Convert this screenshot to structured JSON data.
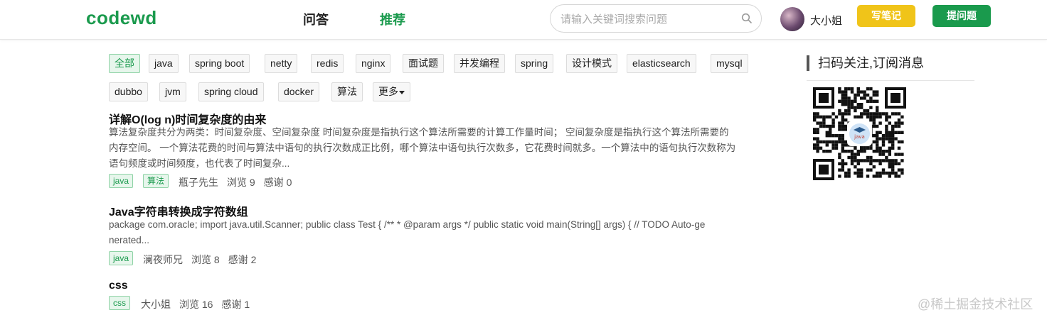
{
  "header": {
    "logo": "codewd",
    "nav": [
      {
        "label": "问答",
        "active": false
      },
      {
        "label": "推荐",
        "active": true
      }
    ],
    "search_placeholder": "请输入关键词搜索问题",
    "user_name": "大小姐",
    "write_note_label": "写笔记",
    "ask_label": "提问题"
  },
  "tags": [
    {
      "label": "全部",
      "active": true
    },
    {
      "label": "java"
    },
    {
      "label": "spring boot"
    },
    {
      "label": "netty"
    },
    {
      "label": "redis"
    },
    {
      "label": "nginx"
    },
    {
      "label": "面试题"
    },
    {
      "label": "并发编程"
    },
    {
      "label": "spring"
    },
    {
      "label": "设计模式"
    },
    {
      "label": "elasticsearch"
    },
    {
      "label": "mysql"
    },
    {
      "label": "dubbo"
    },
    {
      "label": "jvm"
    },
    {
      "label": "spring cloud"
    },
    {
      "label": "docker"
    },
    {
      "label": "算法"
    },
    {
      "label": "更多"
    }
  ],
  "articles": [
    {
      "title": "详解O(log n)时间复杂度的由来",
      "summary_lines": [
        "算法复杂度共分为两类：时间复杂度、空间复杂度 时间复杂度是指执行这个算法所需要的计算工作量时间；  空间复杂度是指执行这个算法所需要的",
        "内存空间。 一个算法花费的时间与算法中语句的执行次数成正比例，哪个算法中语句执行次数多，它花费时间就多。一个算法中的语句执行次数称为",
        "语句频度或时间频度，也代表了时间复杂..."
      ],
      "tags": [
        "java",
        "算法"
      ],
      "author": "瓶子先生",
      "views": "浏览 9",
      "thanks": "感谢 0"
    },
    {
      "title": "Java字符串转换成字符数组",
      "summary_lines": [
        "package com.oracle; import java.util.Scanner; public class Test { /** * @param args */ public static void main(String[] args) { // TODO Auto-ge",
        "nerated..."
      ],
      "tags": [
        "java"
      ],
      "author": "澜夜师兄",
      "views": "浏览 8",
      "thanks": "感谢 2"
    },
    {
      "title": "css",
      "summary_lines": [],
      "tags": [
        "css"
      ],
      "author": "大小姐",
      "views": "浏览 16",
      "thanks": "感谢 1"
    }
  ],
  "sidebar": {
    "title": "扫码关注,订阅消息",
    "qr_badge_text": "java"
  },
  "watermark": "@稀土掘金技术社区",
  "colors": {
    "brand_green": "#1a9a4d",
    "note_yellow": "#f0c419"
  }
}
